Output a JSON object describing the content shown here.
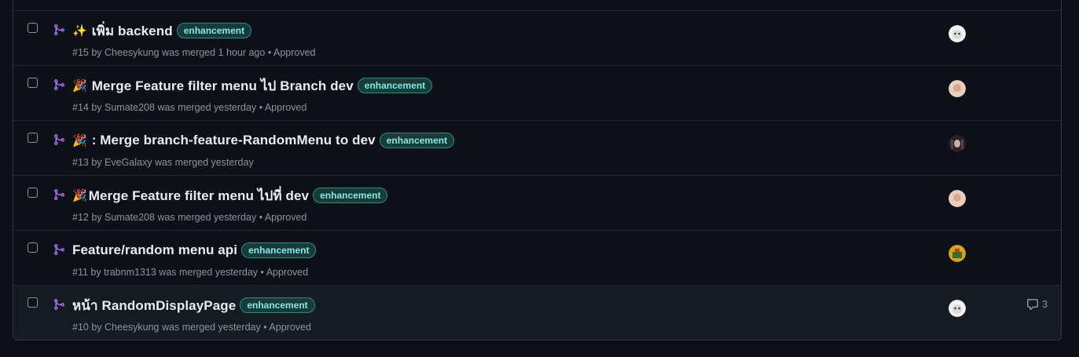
{
  "pull_requests": [
    {
      "emoji": "✨",
      "title": "เพิ่ม backend",
      "label": "enhancement",
      "number": "#15",
      "author": "Cheesykung",
      "merged_text": "was merged 1 hour ago",
      "review": "• Approved",
      "avatar_icon": "avatar-white-icon"
    },
    {
      "emoji": "🎉",
      "title": "Merge Feature filter menu ไป Branch dev",
      "label": "enhancement",
      "number": "#14",
      "author": "Sumate208",
      "merged_text": "was merged yesterday",
      "review": "• Approved",
      "avatar_icon": "avatar-peach-icon"
    },
    {
      "emoji": "🎉",
      "title": ": Merge branch-feature-RandomMenu to dev",
      "label": "enhancement",
      "number": "#13",
      "author": "EveGalaxy",
      "merged_text": "was merged yesterday",
      "review": "",
      "avatar_icon": "avatar-dark-icon"
    },
    {
      "emoji": "🎉",
      "title": "Merge Feature filter menu ไปที่ dev",
      "label": "enhancement",
      "number": "#12",
      "author": "Sumate208",
      "merged_text": "was merged yesterday",
      "review": "• Approved",
      "avatar_icon": "avatar-peach-icon"
    },
    {
      "emoji": "",
      "title": "Feature/random menu api",
      "label": "enhancement",
      "number": "#11",
      "author": "trabnm1313",
      "merged_text": "was merged yesterday",
      "review": "• Approved",
      "avatar_icon": "avatar-pixel-icon"
    },
    {
      "emoji": "",
      "title": "หน้า RandomDisplayPage",
      "label": "enhancement",
      "number": "#10",
      "author": "Cheesykung",
      "merged_text": "was merged yesterday",
      "review": "• Approved",
      "avatar_icon": "avatar-white-icon",
      "comment_count": "3"
    }
  ],
  "colors": {
    "merged_icon": "#a371f7",
    "label_bg": "#153b3a",
    "label_text": "#8ae7e1",
    "label_border": "#2f8888"
  }
}
